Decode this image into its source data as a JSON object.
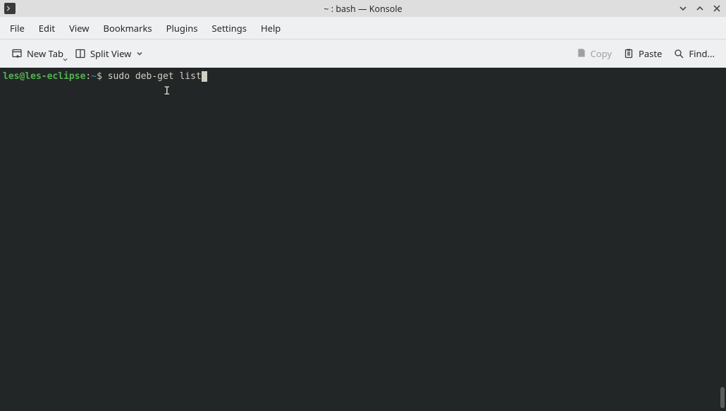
{
  "window": {
    "title": "~ : bash — Konsole"
  },
  "menubar": {
    "items": [
      "File",
      "Edit",
      "View",
      "Bookmarks",
      "Plugins",
      "Settings",
      "Help"
    ]
  },
  "toolbar": {
    "new_tab_label": "New Tab",
    "split_view_label": "Split View",
    "copy_label": "Copy",
    "paste_label": "Paste",
    "find_label": "Find..."
  },
  "terminal": {
    "prompt_user": "les@les-eclipse",
    "prompt_colon": ":",
    "prompt_path": "~",
    "prompt_dollar": "$ ",
    "command": "sudo deb-get list"
  },
  "colors": {
    "terminal_bg": "#232627",
    "prompt_user_color": "#54b153",
    "prompt_path_color": "#2aa198",
    "text_color": "#cfcfc2",
    "window_bg": "#eff0f1",
    "titlebar_bg": "#dedede"
  }
}
